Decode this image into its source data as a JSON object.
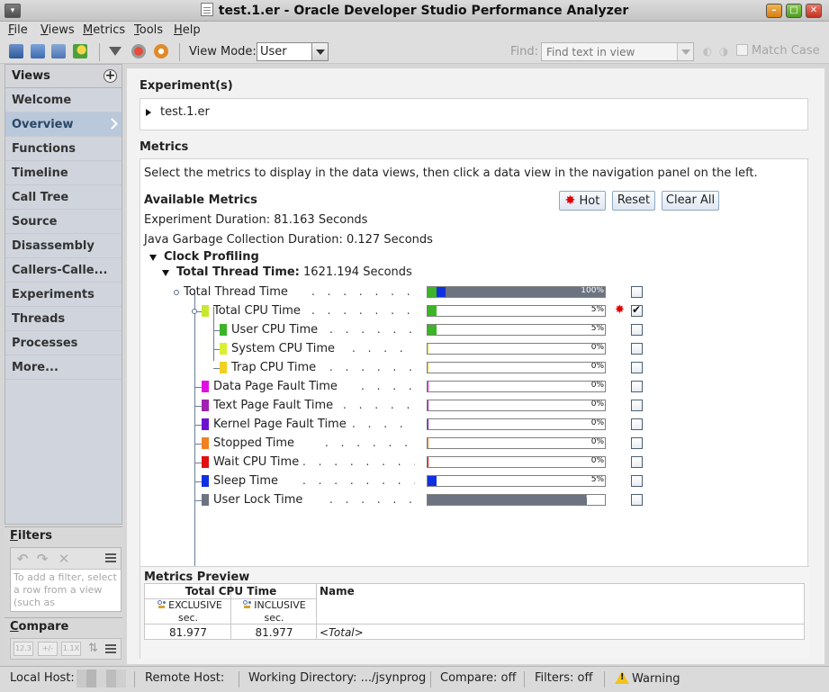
{
  "window": {
    "title": "test.1.er  -  Oracle Developer Studio Performance Analyzer"
  },
  "menubar": [
    "File",
    "Views",
    "Metrics",
    "Tools",
    "Help"
  ],
  "toolbar": {
    "view_mode_label": "View Mode:",
    "view_mode_value": "User",
    "find_label": "Find:",
    "find_placeholder": "Find text in view",
    "match_case_label": "Match Case"
  },
  "nav": {
    "header": "Views",
    "add_glyph": "+",
    "items": [
      "Welcome",
      "Overview",
      "Functions",
      "Timeline",
      "Call Tree",
      "Source",
      "Disassembly",
      "Callers-Calle...",
      "Experiments",
      "Threads",
      "Processes",
      "More..."
    ],
    "selected": "Overview"
  },
  "filters": {
    "title": "Filters",
    "help_text": "To add a filter, select a row from a view (such as"
  },
  "compare": {
    "title": "Compare",
    "buttons": [
      "12.3",
      "+/-",
      "1.1X"
    ]
  },
  "experiments": {
    "title": "Experiment(s)",
    "item": "test.1.er"
  },
  "metrics": {
    "title": "Metrics",
    "instructions": "Select the metrics to display in the data views, then click a data view in the navigation panel on the left.",
    "available_title": "Available Metrics",
    "hot_label": "Hot",
    "reset_label": "Reset",
    "clear_all_label": "Clear All",
    "experiment_duration": "Experiment Duration: 81.163 Seconds",
    "gc_duration": "Java Garbage Collection Duration: 0.127 Seconds",
    "group_title": "Clock Profiling",
    "subgroup_label": "Total Thread Time:",
    "subgroup_value": "1621.194 Seconds",
    "dots": ". . . . . . . . . .",
    "rows": [
      {
        "name": "Total Thread Time",
        "pct_label": "100%",
        "checked": false,
        "hot": false,
        "swatch": "",
        "fill": [
          {
            "color": "#3cb428",
            "pct": 5
          },
          {
            "color": "#1030e0",
            "pct": 5
          },
          {
            "color": "#6d7380",
            "pct": 90
          }
        ]
      },
      {
        "name": "Total CPU Time",
        "pct_label": "5%",
        "checked": true,
        "hot": true,
        "swatch": "#c8e830",
        "fill": [
          {
            "color": "#3cb428",
            "pct": 5
          }
        ]
      },
      {
        "name": "User CPU Time",
        "pct_label": "5%",
        "checked": false,
        "hot": false,
        "swatch": "#3cb428",
        "fill": [
          {
            "color": "#3cb428",
            "pct": 5
          }
        ]
      },
      {
        "name": "System CPU Time",
        "pct_label": "0%",
        "checked": false,
        "hot": false,
        "swatch": "#d8f030",
        "fill": [
          {
            "color": "#d8f030",
            "pct": 0.4
          }
        ]
      },
      {
        "name": "Trap CPU Time",
        "pct_label": "0%",
        "checked": false,
        "hot": false,
        "swatch": "#f0d020",
        "fill": [
          {
            "color": "#f0d020",
            "pct": 0.4
          }
        ]
      },
      {
        "name": "Data Page Fault Time",
        "pct_label": "0%",
        "checked": false,
        "hot": false,
        "swatch": "#e010e0",
        "fill": [
          {
            "color": "#e010e0",
            "pct": 0.4
          }
        ]
      },
      {
        "name": "Text Page Fault Time",
        "pct_label": "0%",
        "checked": false,
        "hot": false,
        "swatch": "#a020b0",
        "fill": [
          {
            "color": "#a020b0",
            "pct": 0.4
          }
        ]
      },
      {
        "name": "Kernel Page Fault Time",
        "pct_label": "0%",
        "checked": false,
        "hot": false,
        "swatch": "#6a10d0",
        "fill": [
          {
            "color": "#6a10d0",
            "pct": 0.4
          }
        ]
      },
      {
        "name": "Stopped Time",
        "pct_label": "0%",
        "checked": false,
        "hot": false,
        "swatch": "#f08020",
        "fill": [
          {
            "color": "#f08020",
            "pct": 0.4
          }
        ]
      },
      {
        "name": "Wait CPU Time",
        "pct_label": "0%",
        "checked": false,
        "hot": false,
        "swatch": "#e01010",
        "fill": [
          {
            "color": "#e01010",
            "pct": 0.4
          }
        ]
      },
      {
        "name": "Sleep Time",
        "pct_label": "5%",
        "checked": false,
        "hot": false,
        "swatch": "#1030e0",
        "fill": [
          {
            "color": "#1030e0",
            "pct": 5
          }
        ]
      },
      {
        "name": "User Lock Time",
        "pct_label": "90%",
        "checked": false,
        "hot": false,
        "swatch": "#6d7380",
        "fill": [
          {
            "color": "#6d7380",
            "pct": 90
          }
        ]
      }
    ]
  },
  "preview": {
    "title": "Metrics Preview",
    "metric_header": "Total CPU Time",
    "exclusive_label": "EXCLUSIVE",
    "inclusive_label": "INCLUSIVE",
    "unit": "sec.",
    "name_header": "Name",
    "row": {
      "exclusive": "81.977",
      "inclusive": "81.977",
      "name": "<Total>"
    }
  },
  "statusbar": {
    "local_host_label": "Local Host:",
    "remote_host_label": "Remote Host:",
    "working_dir_label": "Working Directory:",
    "working_dir_value": ".../jsynprog",
    "compare_label": "Compare:",
    "compare_value": "off",
    "filters_label": "Filters:",
    "filters_value": "off",
    "warning_label": "Warning"
  },
  "colors": {
    "nav_selected_bg": "#b9c8da",
    "hot": "#e00000"
  }
}
